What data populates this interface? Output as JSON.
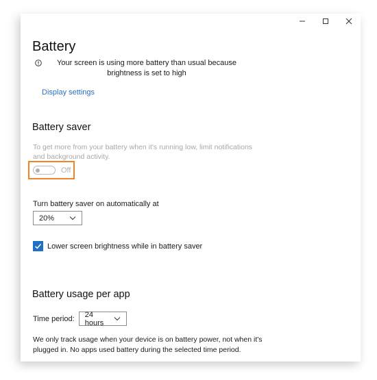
{
  "page": {
    "title": "Battery",
    "warning_text": "Your screen is using more battery than usual because brightness is set to high",
    "display_settings_link": "Display settings"
  },
  "battery_saver": {
    "heading": "Battery saver",
    "description": "To get more from your battery when it's running low, limit notifications and background activity.",
    "toggle_state": "Off",
    "auto_on_label": "Turn battery saver on automatically at",
    "auto_on_value": "20%",
    "lower_brightness_label": "Lower screen brightness while in battery saver",
    "lower_brightness_checked": true
  },
  "usage": {
    "heading": "Battery usage per app",
    "time_period_label": "Time period:",
    "time_period_value": "24 hours",
    "note": "We only track usage when your device is on battery power, not when it's plugged in. No apps used battery during the selected time period."
  },
  "colors": {
    "link": "#2a6fbf",
    "checkbox_accent": "#1f6fc5",
    "highlight_border": "#f08323",
    "disabled_text": "#a8a8a8"
  },
  "icons": {
    "minimize": "minimize-icon",
    "maximize": "maximize-icon",
    "close": "close-icon",
    "info": "info-icon",
    "chevron": "chevron-down-icon",
    "check": "checkmark-icon"
  }
}
